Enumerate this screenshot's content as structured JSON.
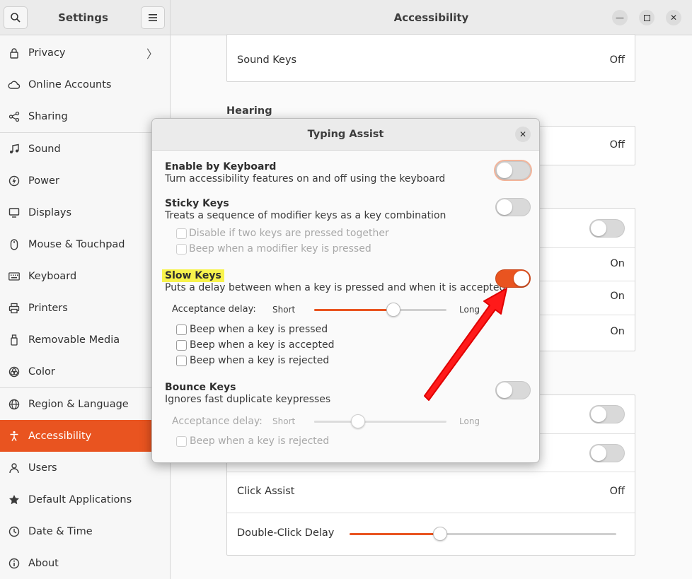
{
  "sidebar": {
    "title": "Settings",
    "items": [
      {
        "label": "Privacy",
        "icon": "lock-icon",
        "has_chevron": true
      },
      {
        "label": "Online Accounts",
        "icon": "cloud-icon"
      },
      {
        "label": "Sharing",
        "icon": "share-icon"
      },
      {
        "label": "Sound",
        "icon": "music-note-icon"
      },
      {
        "label": "Power",
        "icon": "power-icon"
      },
      {
        "label": "Displays",
        "icon": "display-icon"
      },
      {
        "label": "Mouse & Touchpad",
        "icon": "mouse-icon"
      },
      {
        "label": "Keyboard",
        "icon": "keyboard-icon"
      },
      {
        "label": "Printers",
        "icon": "printer-icon"
      },
      {
        "label": "Removable Media",
        "icon": "usb-drive-icon"
      },
      {
        "label": "Color",
        "icon": "color-icon"
      },
      {
        "label": "Region & Language",
        "icon": "globe-icon"
      },
      {
        "label": "Accessibility",
        "icon": "accessibility-icon",
        "active": true
      },
      {
        "label": "Users",
        "icon": "users-icon"
      },
      {
        "label": "Default Applications",
        "icon": "star-icon"
      },
      {
        "label": "Date & Time",
        "icon": "clock-icon"
      },
      {
        "label": "About",
        "icon": "info-icon"
      }
    ]
  },
  "header": {
    "title": "Accessibility"
  },
  "main": {
    "sound_keys": {
      "label": "Sound Keys",
      "value": "Off"
    },
    "hearing_heading": "Hearing",
    "hearing_value": "Off",
    "on_values": [
      "On",
      "On",
      "On"
    ],
    "click_assist": {
      "label": "Click Assist",
      "value": "Off"
    },
    "double_click_delay": {
      "label": "Double-Click Delay",
      "level": 0.34
    }
  },
  "dialog": {
    "title": "Typing Assist",
    "enable_by_keyboard": {
      "title": "Enable by Keyboard",
      "desc": "Turn accessibility features on and off using the keyboard",
      "on": false
    },
    "sticky_keys": {
      "title": "Sticky Keys",
      "desc": "Treats a sequence of modifier keys as a key combination",
      "on": false,
      "options": [
        "Disable if two keys are pressed together",
        "Beep when a modifier key is pressed"
      ]
    },
    "slow_keys": {
      "title": "Slow Keys",
      "desc": "Puts a delay between when a key is pressed and when it is accepted",
      "on": true,
      "delay_label": "Acceptance delay:",
      "short": "Short",
      "long": "Long",
      "delay_level": 0.6,
      "options": [
        "Beep when a key is pressed",
        "Beep when a key is accepted",
        "Beep when a key is rejected"
      ]
    },
    "bounce_keys": {
      "title": "Bounce Keys",
      "desc": "Ignores fast duplicate keypresses",
      "on": false,
      "delay_label": "Acceptance delay:",
      "short": "Short",
      "long": "Long",
      "delay_level": 0.33,
      "options": [
        "Beep when a key is rejected"
      ]
    }
  },
  "colors": {
    "accent": "#e95420",
    "highlight": "#f8f34c",
    "arrow": "#ff1a1a"
  }
}
